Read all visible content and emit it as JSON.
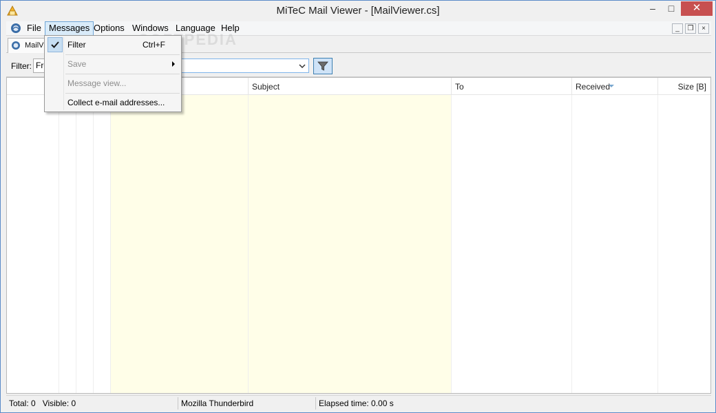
{
  "window": {
    "title": "MiTeC Mail Viewer - [MailViewer.cs]",
    "minimize_glyph": "‒",
    "maximize_glyph": "□",
    "close_glyph": "✕"
  },
  "menubar": {
    "items": [
      {
        "label": "File"
      },
      {
        "label": "Messages"
      },
      {
        "label": "Options"
      },
      {
        "label": "Windows"
      },
      {
        "label": "Language"
      },
      {
        "label": "Help"
      }
    ],
    "mdi_minimize": "_",
    "mdi_restore": "❒",
    "mdi_close": "×"
  },
  "tab": {
    "label": "MailViewer.cs"
  },
  "filterbar": {
    "label": "Filter:",
    "field_value": "From",
    "text_value": ""
  },
  "grid": {
    "columns": [
      {
        "label": ""
      },
      {
        "label": ""
      },
      {
        "label": ""
      },
      {
        "label": ""
      },
      {
        "label": ""
      },
      {
        "label": "Subject"
      },
      {
        "label": "To"
      },
      {
        "label": "Received"
      },
      {
        "label": "Size [B]"
      }
    ],
    "sorted_column": "Received"
  },
  "statusbar": {
    "counts": "Total: 0   Visible: 0",
    "source": "Mozilla Thunderbird",
    "elapsed": "Elapsed time: 0.00 s"
  },
  "messages_menu": {
    "items": [
      {
        "label": "Filter",
        "shortcut": "Ctrl+F",
        "checked": true,
        "disabled": false
      },
      {
        "label": "Save",
        "has_submenu": true,
        "disabled": true
      },
      {
        "label": "Message view...",
        "disabled": true
      },
      {
        "label": "Collect e-mail addresses...",
        "disabled": false
      }
    ]
  },
  "watermark": "SOFTPEDIA",
  "colors": {
    "accent": "#6fa5d6",
    "highlight_column": "#fffee8",
    "close_button": "#c75050"
  }
}
